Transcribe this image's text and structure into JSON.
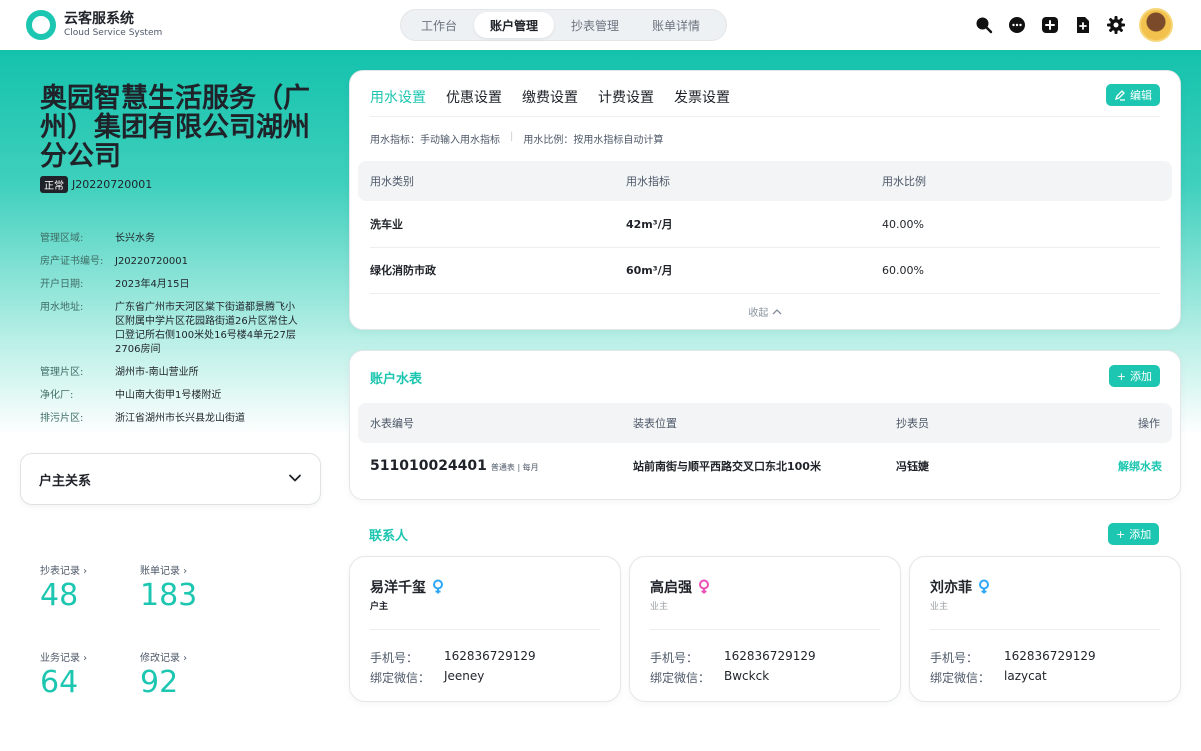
{
  "app": {
    "title": "云客服系统",
    "subtitle": "Cloud Service System"
  },
  "nav": {
    "tabs": [
      "工作台",
      "账户管理",
      "抄表管理",
      "账单详情"
    ],
    "active": 1
  },
  "header_icons": [
    "search-icon",
    "chat-icon",
    "add-icon",
    "file-add-icon",
    "gear-icon"
  ],
  "account": {
    "company": "奥园智慧生活服务（广州）集团有限公司湖州分公司",
    "status": "正常",
    "code": "J20220720001",
    "info": [
      {
        "key": "管理区域:",
        "value": "长兴水务"
      },
      {
        "key": "房产证书编号:",
        "value": "J20220720001"
      },
      {
        "key": "开户日期:",
        "value": "2023年4月15日"
      },
      {
        "key": "用水地址:",
        "value": "广东省广州市天河区棠下街道都景腾飞小区附属中学片区花园路街道26片区常住人口登记所右侧100米处16号楼4单元27层2706房间"
      },
      {
        "key": "管理片区:",
        "value": "湖州市-南山营业所"
      },
      {
        "key": "净化厂:",
        "value": "中山南大街甲1号楼附近"
      },
      {
        "key": "排污片区:",
        "value": "浙江省湖州市长兴县龙山街道"
      }
    ]
  },
  "owner_relation": {
    "label": "户主关系"
  },
  "stats": [
    {
      "label": "抄表记录 ›",
      "value": "48"
    },
    {
      "label": "账单记录 ›",
      "value": "183"
    },
    {
      "label": "业务记录 ›",
      "value": "64"
    },
    {
      "label": "修改记录 ›",
      "value": "92"
    }
  ],
  "settings": {
    "tabs": [
      "用水设置",
      "优惠设置",
      "缴费设置",
      "计费设置",
      "发票设置"
    ],
    "active": 0,
    "edit_label": "编辑",
    "indicator": "用水指标：手动输入用水指标",
    "ratio": "用水比例：按用水指标自动计算",
    "columns": [
      "用水类别",
      "用水指标",
      "用水比例"
    ],
    "rows": [
      {
        "category": "洗车业",
        "quota": "42m³/月",
        "ratio": "40.00%"
      },
      {
        "category": "绿化消防市政",
        "quota": "60m³/月",
        "ratio": "60.00%"
      }
    ],
    "collapse_label": "收起"
  },
  "meters": {
    "title": "账户水表",
    "add_label": "添加",
    "columns": [
      "水表编号",
      "装表位置",
      "抄表员",
      "操作"
    ],
    "rows": [
      {
        "number": "511010024401",
        "meta": "普通表 | 每月",
        "location": "站前南街与顺平西路交叉口东北100米",
        "reader": "冯钰婕",
        "action": "解绑水表"
      }
    ]
  },
  "contacts": {
    "title": "联系人",
    "add_label": "添加",
    "phone_key": "手机号：",
    "wechat_key": "绑定微信：",
    "items": [
      {
        "name": "易洋千玺",
        "gender_icon": "female-icon",
        "gender_color": "#2fa7f5",
        "role": "户主",
        "phone": "162836729129",
        "wechat": "Jeeney"
      },
      {
        "name": "高启强",
        "gender_icon": "female-icon",
        "gender_color": "#e94fb4",
        "role": "业主",
        "phone": "162836729129",
        "wechat": "Bwckck"
      },
      {
        "name": "刘亦菲",
        "gender_icon": "female-icon",
        "gender_color": "#2fa7f5",
        "role": "业主",
        "phone": "162836729129",
        "wechat": "lazycat"
      }
    ]
  },
  "colors": {
    "accent": "#1dc6b0",
    "text": "#1f2329"
  }
}
